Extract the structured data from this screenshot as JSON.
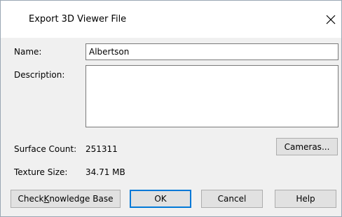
{
  "dialog": {
    "title": "Export 3D Viewer File",
    "close_symbol": "close-icon"
  },
  "form": {
    "name_label": "Name:",
    "name_value": "Albertson",
    "description_label": "Description:",
    "description_value": ""
  },
  "info": {
    "surface_count_label": "Surface Count:",
    "surface_count_value": "251311",
    "texture_size_label": "Texture Size:",
    "texture_size_value": "34.71 MB"
  },
  "buttons": {
    "cameras": "Cameras...",
    "check_kb_prefix": "Check ",
    "check_kb_mnemonic": "K",
    "check_kb_suffix": "nowledge Base",
    "ok": "OK",
    "cancel": "Cancel",
    "help": "Help"
  },
  "colors": {
    "focus_border": "#0078d7",
    "dialog_bg": "#f0f0f0",
    "title_bg": "#ffffff"
  }
}
